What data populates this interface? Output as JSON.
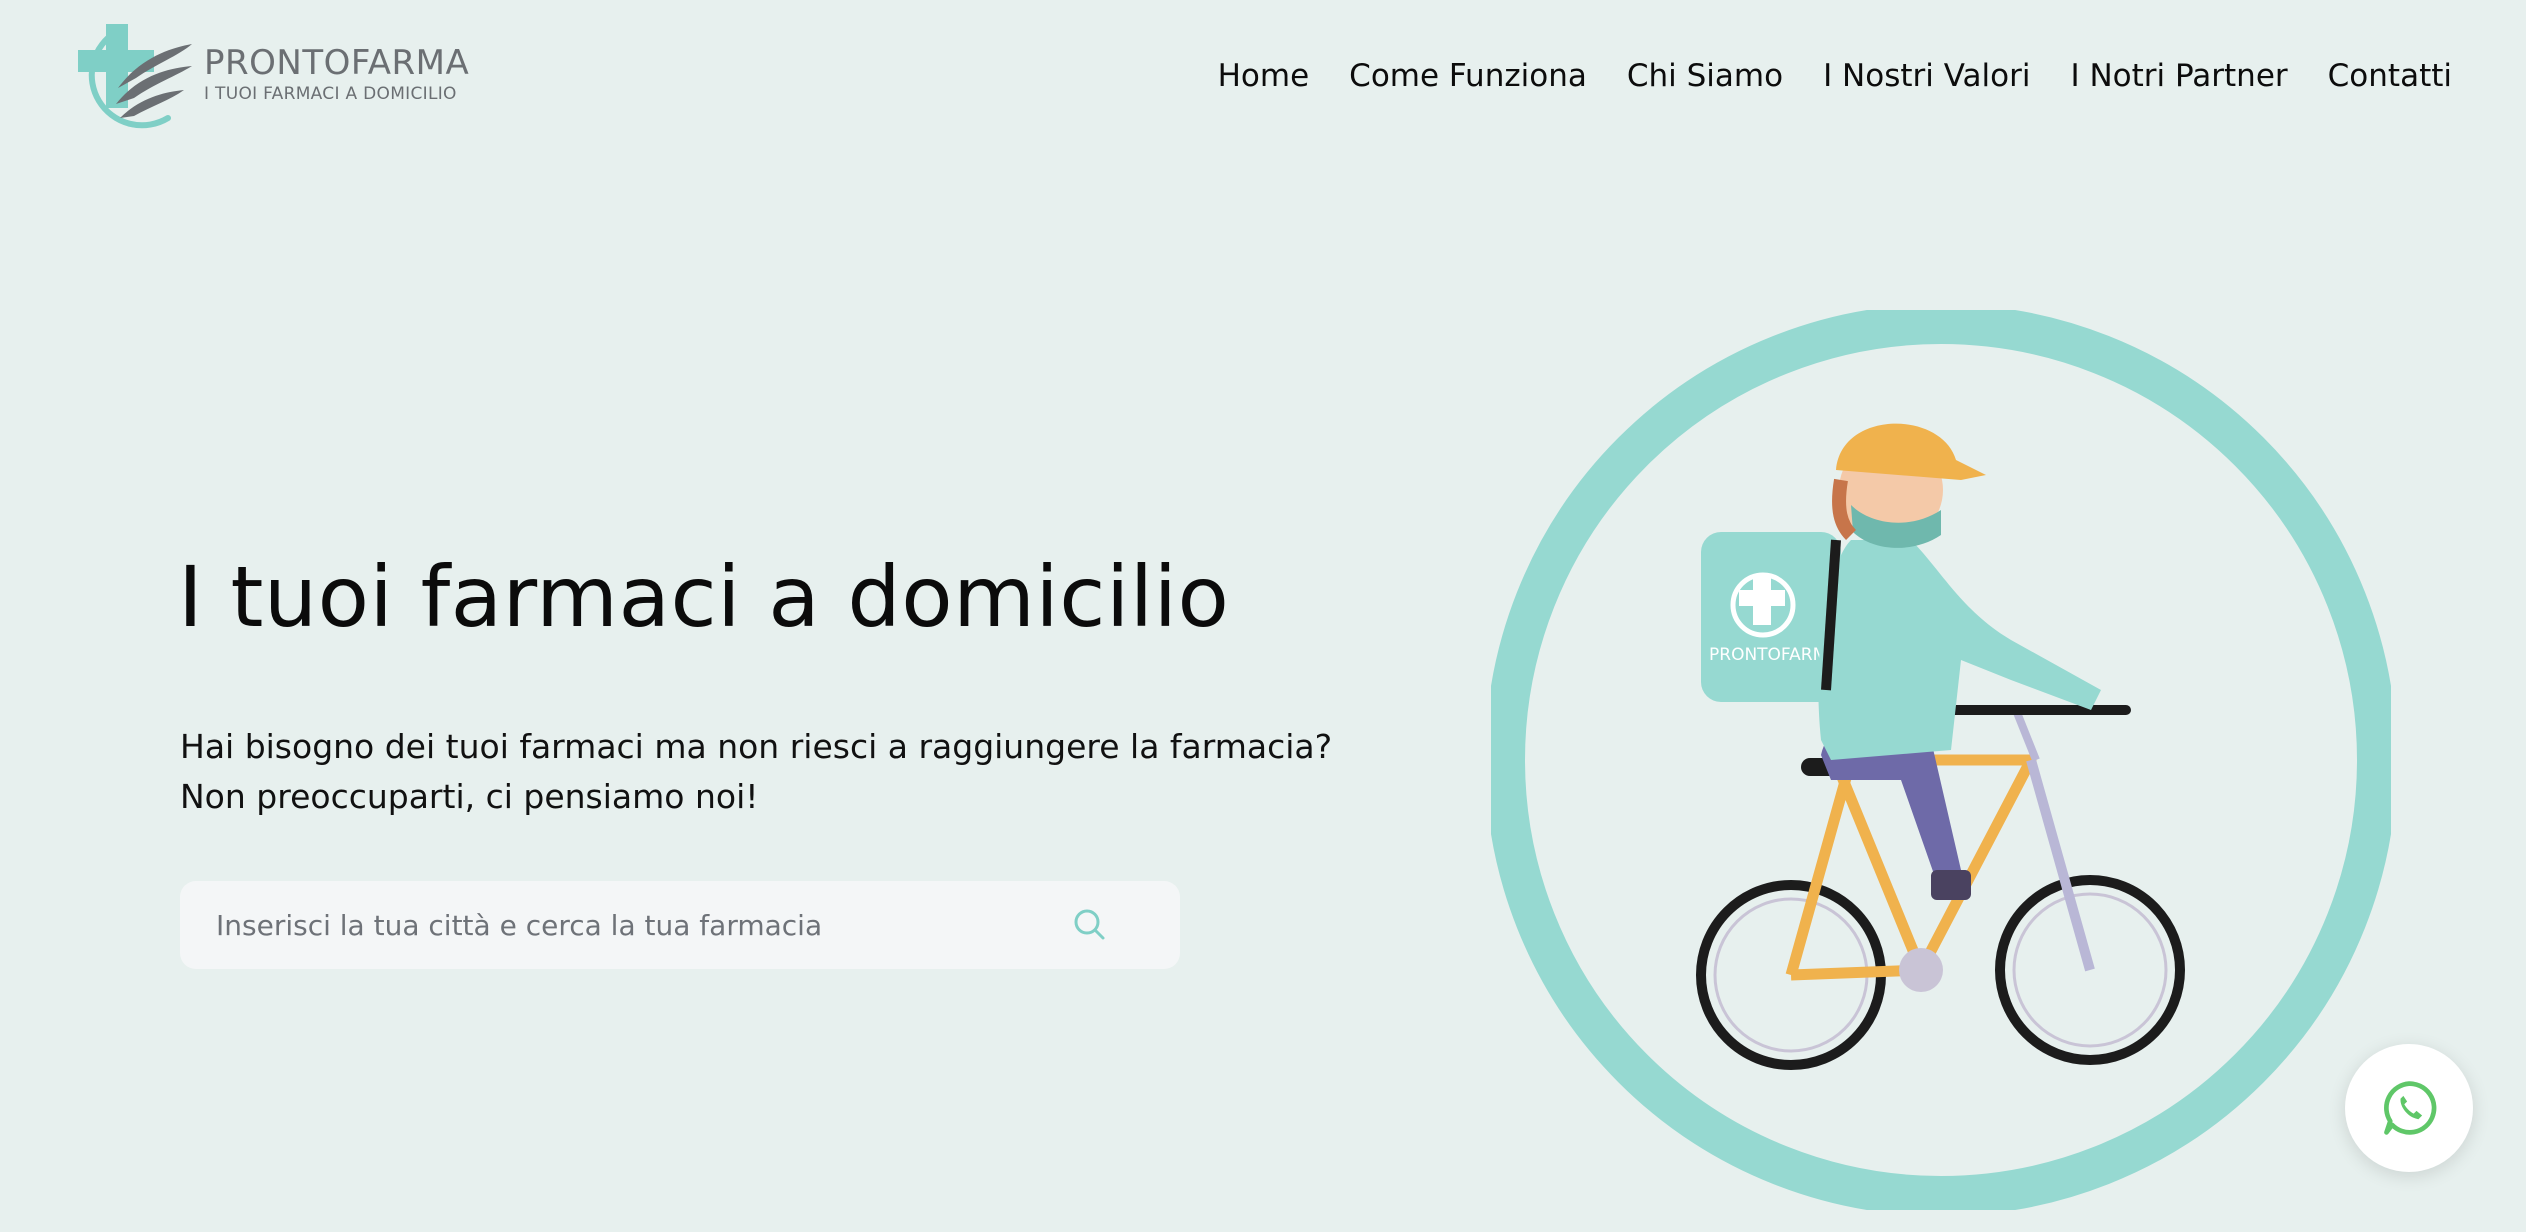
{
  "brand": {
    "name": "PRONTOFARMA",
    "tagline": "I TUOI FARMACI A DOMICILIO"
  },
  "nav": {
    "items": [
      {
        "label": "Home"
      },
      {
        "label": "Come Funziona"
      },
      {
        "label": "Chi Siamo"
      },
      {
        "label": "I Nostri Valori"
      },
      {
        "label": "I Notri Partner"
      },
      {
        "label": "Contatti"
      }
    ]
  },
  "hero": {
    "title": "I tuoi farmaci a domicilio",
    "subtitle_line1": "Hai bisogno dei tuoi farmaci ma non riesci a raggiungere la farmacia?",
    "subtitle_line2": "Non preoccuparti, ci pensiamo noi!"
  },
  "search": {
    "placeholder": "Inserisci la tua città e cerca la tua farmacia",
    "value": "",
    "icon": "search-icon"
  },
  "illustration": {
    "bag_label": "PRONTOFARMA"
  },
  "colors": {
    "background": "#e7f0ee",
    "accent_teal": "#96d9d1",
    "logo_teal": "#7fcfc6",
    "logo_gray": "#6b6f73",
    "whatsapp_green": "#5fc768"
  },
  "whatsapp": {
    "icon": "whatsapp-icon"
  }
}
